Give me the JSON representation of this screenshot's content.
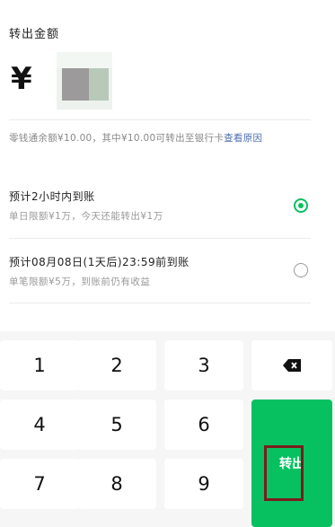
{
  "header": {
    "title": "转出金额",
    "currency_symbol": "¥"
  },
  "balance": {
    "text": "零钱通余额¥10.00，其中¥10.00可转出至银行卡",
    "link": "查看原因"
  },
  "options": [
    {
      "title": "预计2小时内到账",
      "subtitle": "单日限额¥1万，今天还能转出¥1万",
      "selected": true
    },
    {
      "title": "预计08月08日(1天后)23:59前到账",
      "subtitle": "单笔限额¥5万，到账前仍有收益",
      "selected": false
    }
  ],
  "keypad": {
    "keys": [
      "1",
      "2",
      "3",
      "4",
      "5",
      "6",
      "7",
      "8",
      "9"
    ],
    "delete_icon": "backspace-icon",
    "transfer_label": "转出"
  },
  "colors": {
    "accent": "#07c160",
    "link": "#4a6eb0",
    "highlight": "#7a1c1c"
  }
}
